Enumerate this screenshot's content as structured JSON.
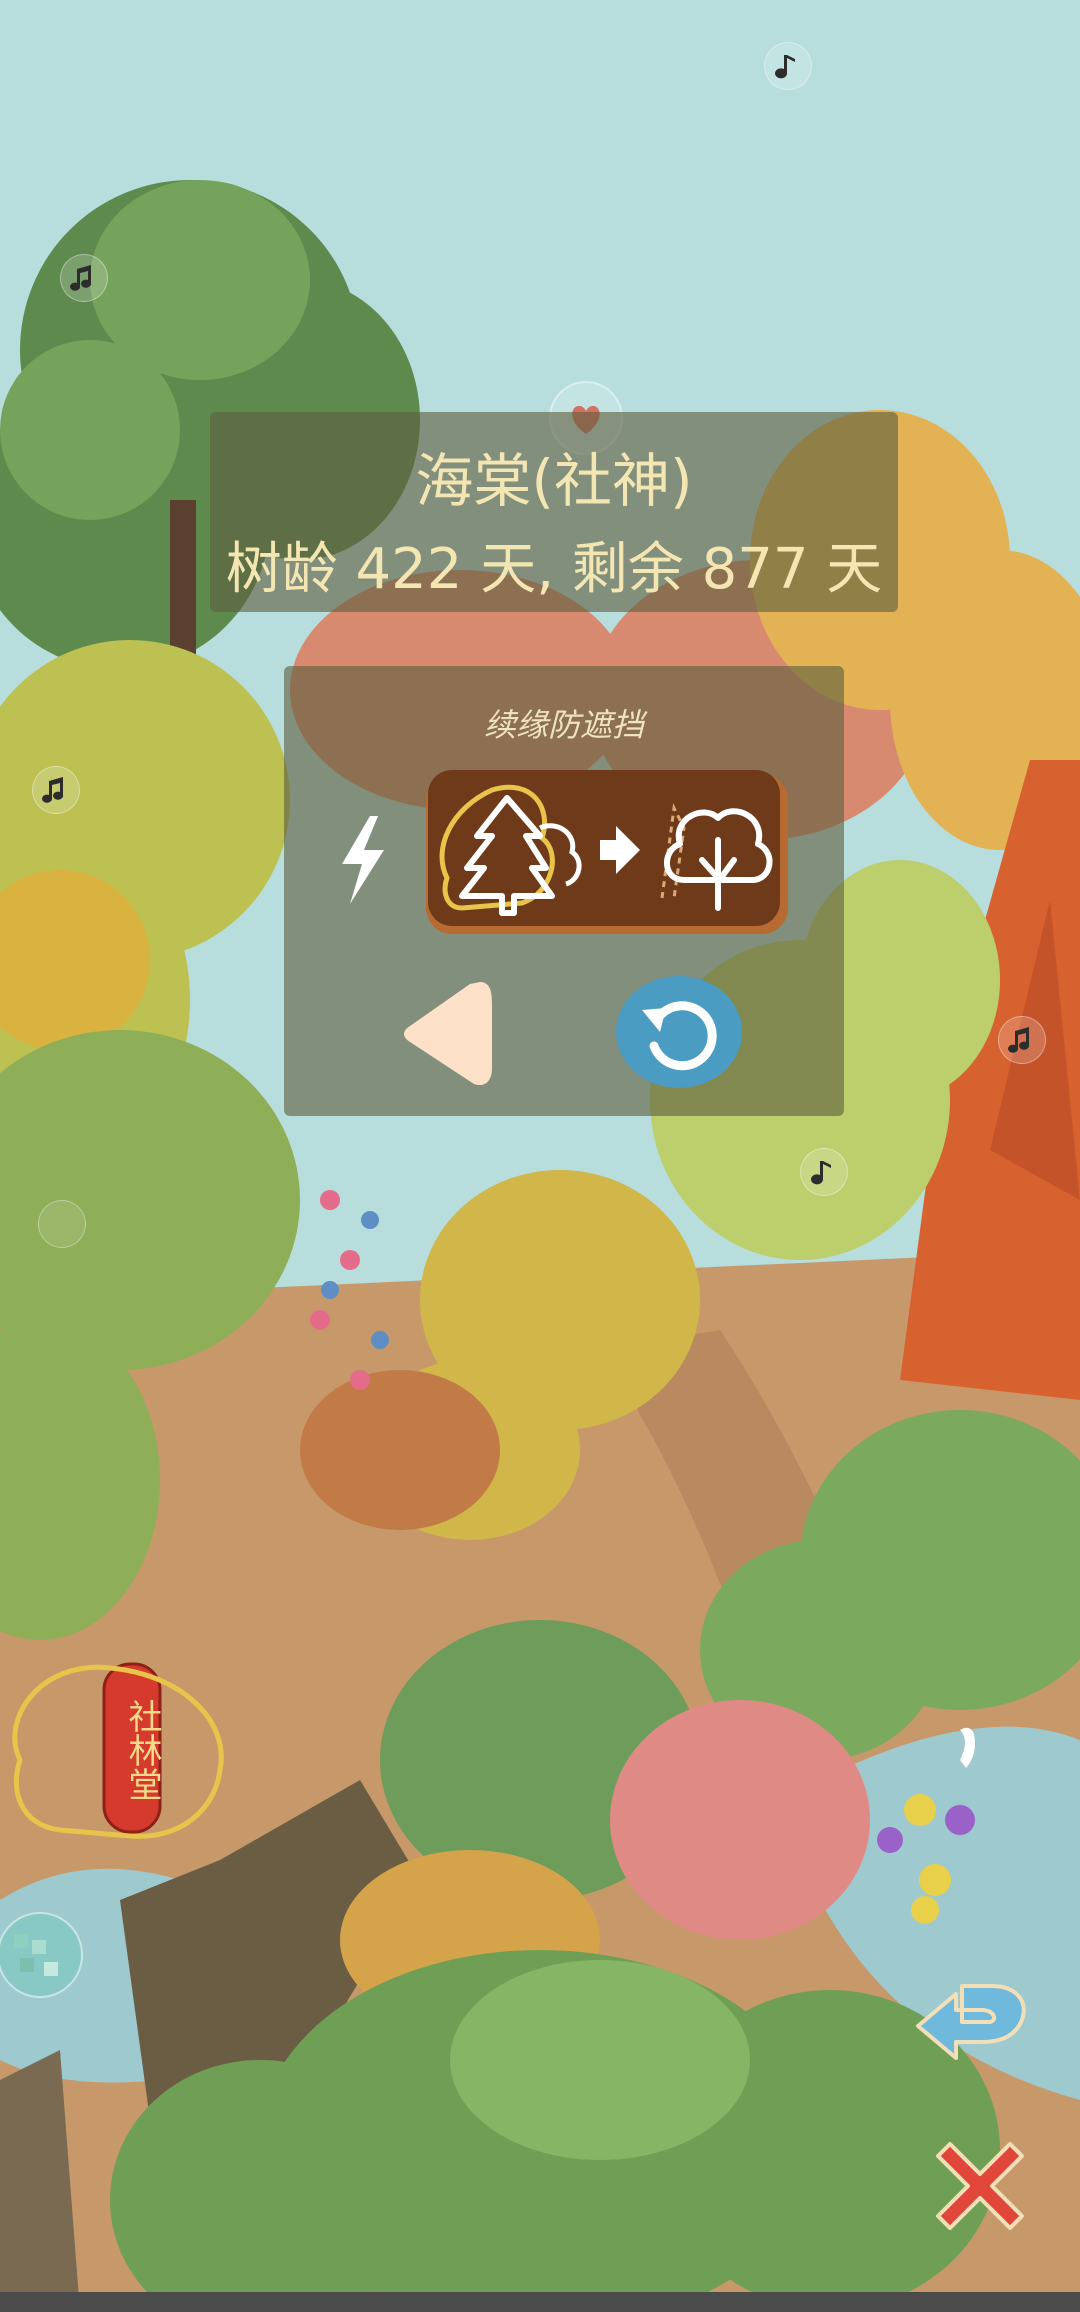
{
  "tree_info": {
    "name": "海棠(社神)",
    "age_line": "树龄 422 天, 剩余 877 天"
  },
  "control_panel": {
    "title": "续缘防遮挡"
  },
  "signboard": {
    "text": "社林堂"
  },
  "icons": {
    "lightning": "lightning-icon",
    "tree_swap": "tree-swap-icon",
    "back": "back-arrow-icon",
    "undo": "undo-icon",
    "return": "return-arrow-icon",
    "close": "close-icon",
    "music": "music-note-icon",
    "heart": "heart-bubble-icon"
  },
  "colors": {
    "sky": "#b7dedd",
    "panel_text": "#f4e6b2",
    "swap_button": "#6e3a1a",
    "undo_button": "#4b9cc2",
    "close": "#e0473a",
    "return": "#6fb9dc"
  }
}
